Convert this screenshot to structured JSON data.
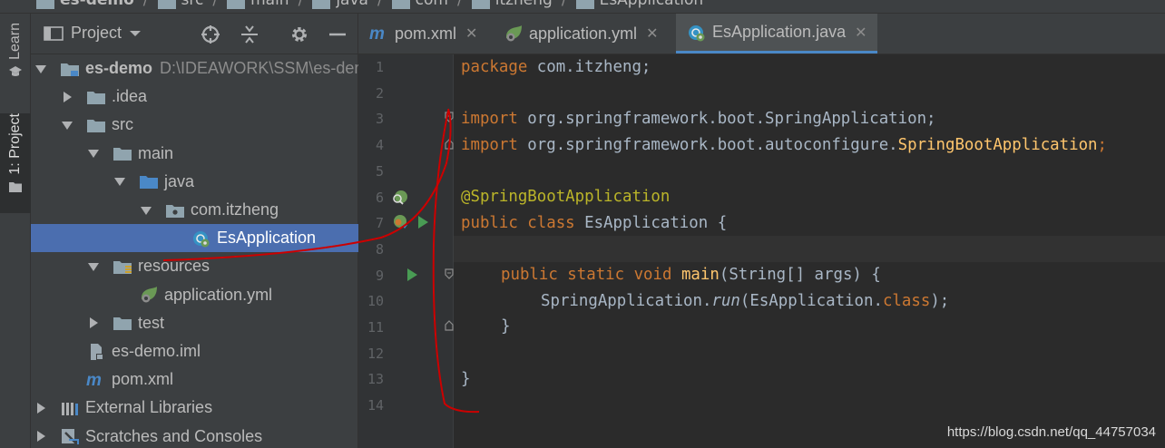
{
  "breadcrumb": [
    "es-demo",
    "src",
    "main",
    "java",
    "com",
    "itzheng",
    "EsApplication"
  ],
  "tool_stripe": {
    "learn_label": "Learn",
    "project_label": "1: Project"
  },
  "project_panel": {
    "title": "Project",
    "tree": [
      {
        "label": "es-demo",
        "path": "D:\\IDEAWORK\\SSM\\es-demo",
        "icon": "module-folder-icon",
        "state": "expanded"
      },
      {
        "label": ".idea",
        "icon": "folder-icon",
        "state": "collapsed"
      },
      {
        "label": "src",
        "icon": "folder-icon",
        "state": "expanded"
      },
      {
        "label": "main",
        "icon": "folder-icon",
        "state": "expanded"
      },
      {
        "label": "java",
        "icon": "source-folder-icon",
        "state": "expanded"
      },
      {
        "label": "com.itzheng",
        "icon": "package-icon",
        "state": "expanded"
      },
      {
        "label": "EsApplication",
        "icon": "spring-boot-class-icon",
        "state": "selected"
      },
      {
        "label": "resources",
        "icon": "resources-folder-icon",
        "state": "expanded"
      },
      {
        "label": "application.yml",
        "icon": "spring-config-icon",
        "state": "leaf"
      },
      {
        "label": "test",
        "icon": "folder-icon",
        "state": "collapsed"
      },
      {
        "label": "es-demo.iml",
        "icon": "iml-file-icon",
        "state": "leaf"
      },
      {
        "label": "pom.xml",
        "icon": "maven-icon",
        "state": "leaf"
      },
      {
        "label": "External Libraries",
        "icon": "libraries-icon",
        "state": "collapsed"
      },
      {
        "label": "Scratches and Consoles",
        "icon": "scratches-icon",
        "state": "collapsed"
      }
    ]
  },
  "tabs": [
    {
      "label": "pom.xml",
      "icon": "maven-icon",
      "active": false
    },
    {
      "label": "application.yml",
      "icon": "spring-config-icon",
      "active": false
    },
    {
      "label": "EsApplication.java",
      "icon": "spring-boot-class-icon",
      "active": true
    }
  ],
  "line_numbers": [
    "1",
    "2",
    "3",
    "4",
    "5",
    "6",
    "7",
    "8",
    "9",
    "10",
    "11",
    "12",
    "13",
    "14"
  ],
  "code": {
    "l1_kw": "package",
    "l1_rest": " com.itzheng;",
    "l3_kw": "import",
    "l3_rest": " org.springframework.boot.SpringApplication;",
    "l4_kw": "import",
    "l4_rest": " org.springframework.boot.autoconfigure.",
    "l4_cls": "SpringBootApplication",
    "l4_end": ";",
    "l6_ann": "@SpringBootApplication",
    "l7_kw": "public class",
    "l7_rest": " EsApplication {",
    "l9_kw": "public static void",
    "l9_fn": "main",
    "l9_rest": "(String[] args) {",
    "l10_a": "SpringApplication.",
    "l10_run": "run",
    "l10_b": "(EsApplication.",
    "l10_kw": "class",
    "l10_c": ");",
    "l11": "}",
    "l13": "}"
  },
  "watermark": "https://blog.csdn.net/qq_44757034",
  "colors": {
    "keyword": "#cc7832",
    "annotation": "#bbb529",
    "method": "#ffc66d",
    "selection": "#4b6eaf",
    "annotation_stroke": "#cc0000"
  }
}
